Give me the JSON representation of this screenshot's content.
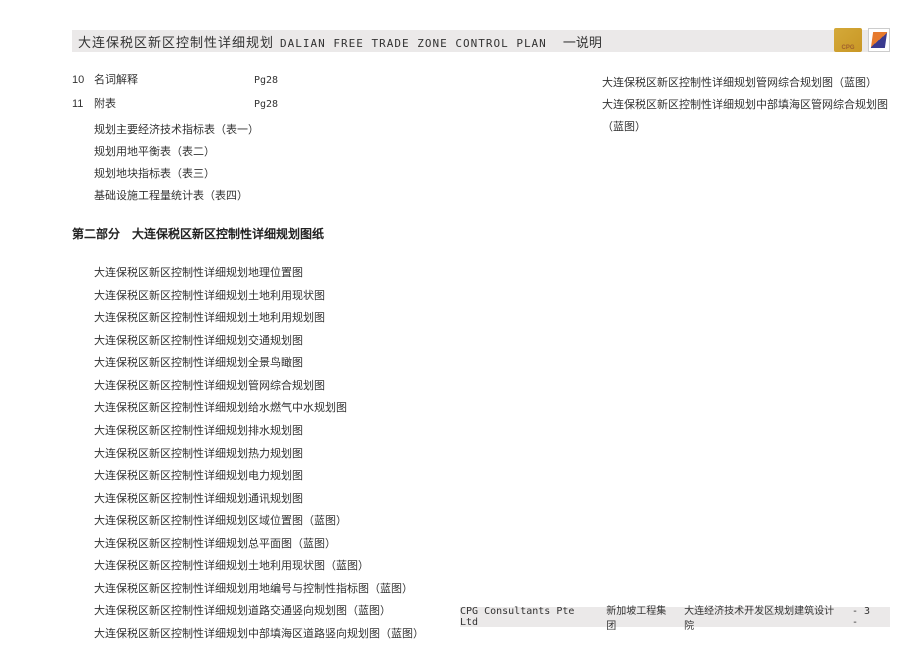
{
  "header": {
    "title_cn": "大连保税区新区控制性详细规划",
    "title_en": "DALIAN FREE TRADE ZONE CONTROL PLAN",
    "section": "一说明"
  },
  "toc": {
    "items": [
      {
        "num": "10",
        "label": "名词解释",
        "page": "Pg28"
      },
      {
        "num": "11",
        "label": "附表",
        "page": "Pg28"
      }
    ],
    "sub_items": [
      "规划主要经济技术指标表（表一）",
      "规划用地平衡表（表二）",
      "规划地块指标表（表三）",
      "基础设施工程量统计表（表四）"
    ]
  },
  "part2": {
    "title": "第二部分　大连保税区新区控制性详细规划图纸",
    "drawings": [
      "大连保税区新区控制性详细规划地理位置图",
      "大连保税区新区控制性详细规划土地利用现状图",
      "大连保税区新区控制性详细规划土地利用规划图",
      "大连保税区新区控制性详细规划交通规划图",
      "大连保税区新区控制性详细规划全景鸟瞰图",
      "大连保税区新区控制性详细规划管网综合规划图",
      "大连保税区新区控制性详细规划给水燃气中水规划图",
      "大连保税区新区控制性详细规划排水规划图",
      "大连保税区新区控制性详细规划热力规划图",
      "大连保税区新区控制性详细规划电力规划图",
      "大连保税区新区控制性详细规划通讯规划图",
      "大连保税区新区控制性详细规划区域位置图（蓝图）",
      "大连保税区新区控制性详细规划总平面图（蓝图）",
      "大连保税区新区控制性详细规划土地利用现状图（蓝图）",
      "大连保税区新区控制性详细规划用地编号与控制性指标图（蓝图）",
      "大连保税区新区控制性详细规划道路交通竖向规划图（蓝图）",
      "大连保税区新区控制性详细规划中部填海区道路竖向规划图（蓝图）"
    ]
  },
  "right_col": {
    "items": [
      "大连保税区新区控制性详细规划管网综合规划图（蓝图）",
      "大连保税区新区控制性详细规划中部填海区管网综合规划图（蓝图）"
    ]
  },
  "footer": {
    "company_en": "CPG Consultants Pte Ltd",
    "company_cn1": "新加坡工程集团",
    "company_cn2": "大连经济技术开发区规划建筑设计院",
    "page": "- 3 -"
  }
}
